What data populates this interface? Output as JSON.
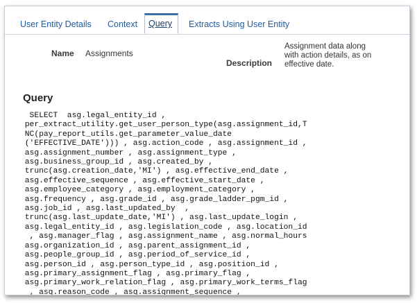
{
  "tabs": {
    "user_entity_details": "User Entity Details",
    "context": "Context",
    "query": "Query",
    "extracts": "Extracts Using User Entity"
  },
  "details": {
    "name_label": "Name",
    "name_value": "Assignments",
    "description_label": "Description",
    "description_value": "Assignment data along with action details, as on effective date."
  },
  "query_section": {
    "title": "Query",
    "lines": [
      "  SELECT  asg.legal_entity_id ,",
      " per_extract_utility.get_user_person_type(asg.assignment_id,T",
      " NC(pay_report_utils.get_parameter_value_date",
      " ('EFFECTIVE_DATE'))) , asg.action_code , asg.assignment_id ,",
      " asg.assignment_number , asg.assignment_type ,",
      " asg.business_group_id , asg.created_by ,",
      " trunc(asg.creation_date,'MI') , asg.effective_end_date ,",
      " asg.effective_sequence , asg.effective_start_date ,",
      " asg.employee_category , asg.employment_category ,",
      " asg.frequency , asg.grade_id , asg.grade_ladder_pgm_id ,",
      " asg.job_id , asg.last_updated_by  ,",
      " trunc(asg.last_update_date,'MI') , asg.last_update_login ,",
      " asg.legal_entity_id , asg.legislation_code , asg.location_id",
      "  , asg.manager_flag , asg.assignment_name , asg.normal_hours",
      " asg.organization_id , asg.parent_assignment_id ,",
      " asg.people_group_id , asg.period_of_service_id ,",
      " asg.person_id , asg.person_type_id , asg.position_id ,",
      " asg.primary_assignment_flag , asg.primary_flag ,",
      " asg.primary_work_relation_flag , asg.primary_work_terms_flag",
      "  , asg.reason_code , asg.assignment_sequence ,"
    ]
  }
}
